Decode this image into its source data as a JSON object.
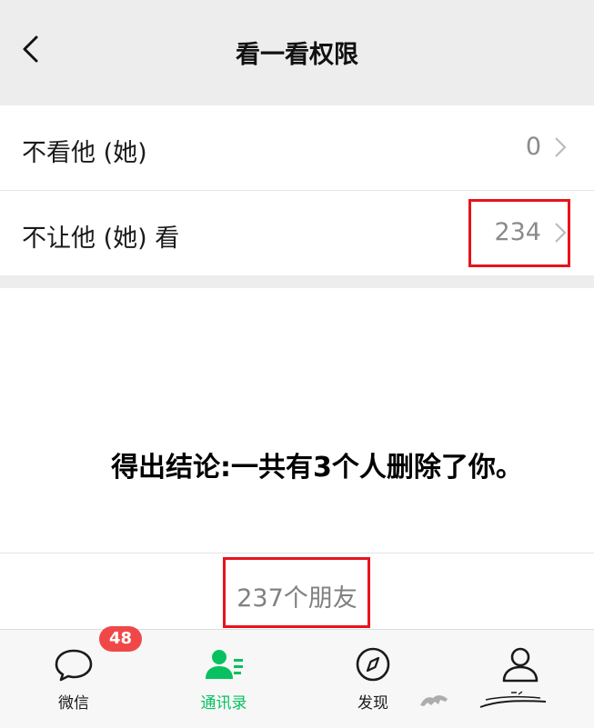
{
  "header": {
    "title": "看一看权限"
  },
  "rows": [
    {
      "label": "不看他 (她)",
      "value": "0"
    },
    {
      "label": "不让他 (她) 看",
      "value": "234"
    }
  ],
  "annotation": "得出结论:一共有3个人删除了你。",
  "friend_count": "237个朋友",
  "tabs": [
    {
      "label": "微信",
      "badge": "48",
      "icon": "chat-bubble-icon"
    },
    {
      "label": "通讯录",
      "icon": "contacts-icon",
      "active": true
    },
    {
      "label": "发现",
      "icon": "compass-icon"
    },
    {
      "label": "",
      "icon": "person-icon"
    }
  ],
  "colors": {
    "accent": "#07c160",
    "highlight": "#e8131b",
    "badge": "#f04848"
  }
}
